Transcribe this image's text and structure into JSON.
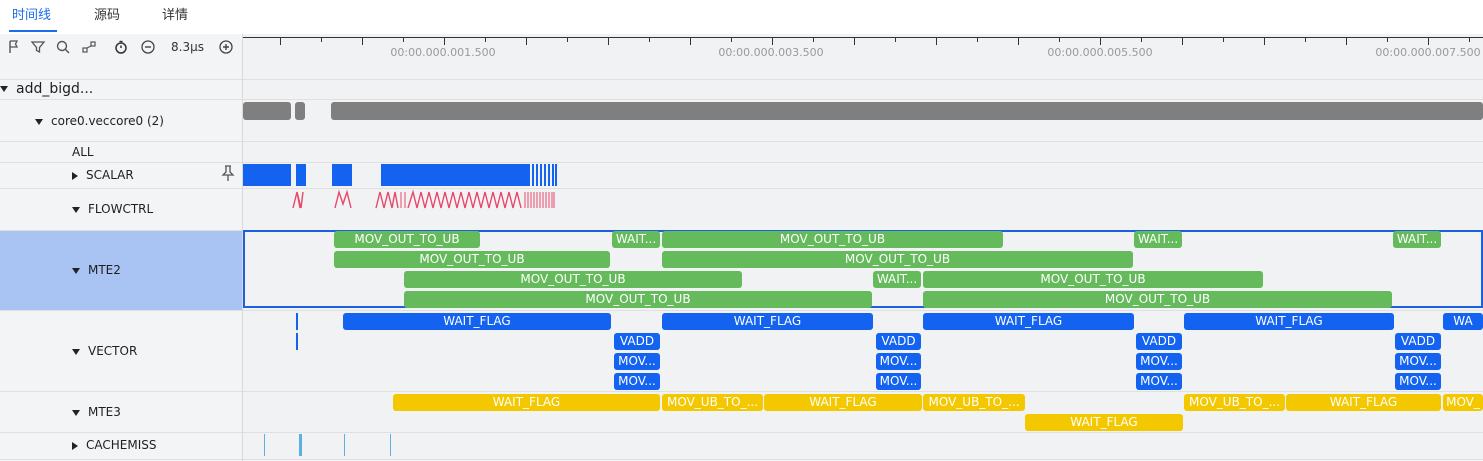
{
  "tabs": {
    "timeline": "时间线",
    "source": "源码",
    "details": "详情"
  },
  "toolbar": {
    "icons": [
      "flag-icon",
      "filter-icon",
      "search-icon",
      "fit-icon",
      "timer-icon",
      "zoom-out-icon",
      "zoom-in-icon"
    ],
    "zoom_label": "8.3μs"
  },
  "ruler": {
    "labels": [
      "00:00.000.001.500",
      "00:00.000.003.500",
      "00:00.000.005.500",
      "00:00.000.007.500"
    ]
  },
  "tree": {
    "root": "add_bigd...",
    "core": "core0.veccore0 (2)",
    "rows": {
      "all": "ALL",
      "scalar": "SCALAR",
      "flowctrl": "FLOWCTRL",
      "mte2": "MTE2",
      "vector": "VECTOR",
      "mte3": "MTE3",
      "cachemiss": "CACHEMISS"
    }
  },
  "slices": {
    "mov_out_to_ub": "MOV_OUT_TO_UB",
    "wait_short": "WAIT...",
    "wait_flag": "WAIT_FLAG",
    "wait_cut": "WA",
    "vadd": "VADD",
    "mov_short": "MOV...",
    "mov_ub_to": "MOV_UB_TO_...",
    "mov_ub_to_cut": "MOV_"
  },
  "colors": {
    "accent": "#1c6ee8",
    "mte2_green": "#65bb5c",
    "vector_blue": "#1463f0",
    "mte3_yellow": "#f4c800",
    "flow_red": "#e8486a",
    "cachemiss_cyan": "#5ab0e0",
    "core_gray": "#7f7f7f"
  }
}
